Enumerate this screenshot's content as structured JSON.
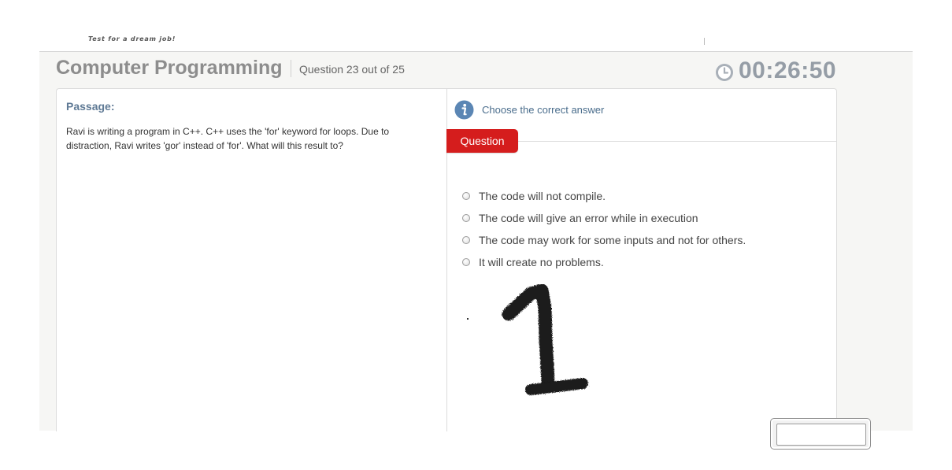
{
  "header": {
    "tagline": "Test for a dream job!"
  },
  "test": {
    "title": "Computer Programming",
    "question_counter": "Question 23 out of 25",
    "timer": "00:26:50"
  },
  "passage": {
    "heading": "Passage:",
    "text": "Ravi is writing a program in C++. C++ uses the 'for' keyword for loops. Due to distraction, Ravi writes 'gor' instead of 'for'. What will this result to?"
  },
  "question_panel": {
    "instruction": "Choose the correct answer",
    "tab_label": "Question",
    "options": [
      {
        "label": "The code will not compile.",
        "selected": false
      },
      {
        "label": "The code will give an error while in execution",
        "selected": false
      },
      {
        "label": "The code may work for some inputs and not for others.",
        "selected": false
      },
      {
        "label": "It will create no problems.",
        "selected": false
      }
    ],
    "handwritten_answer": "1"
  },
  "colors": {
    "accent_red": "#d51d1d",
    "title_gray": "#8d8d8d",
    "timer_gray": "#959da6",
    "info_blue": "#5b86b4",
    "passage_heading": "#5f7a95"
  },
  "icons": {
    "clock": "clock-icon",
    "info": "info-icon"
  }
}
